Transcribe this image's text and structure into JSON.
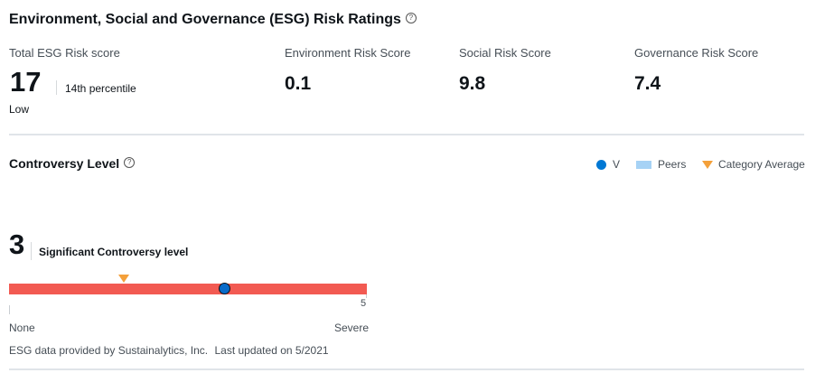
{
  "esg": {
    "title": "Environment, Social and Governance (ESG) Risk Ratings",
    "help_icon": "question-circle-icon",
    "total_label": "Total ESG Risk score",
    "total_value": "17",
    "percentile": "14th percentile",
    "risk_level": "Low",
    "environment_label": "Environment Risk Score",
    "environment_value": "0.1",
    "social_label": "Social Risk Score",
    "social_value": "9.8",
    "governance_label": "Governance Risk Score",
    "governance_value": "7.4"
  },
  "controversy": {
    "title": "Controversy Level",
    "legend": {
      "ticker": "V",
      "peers": "Peers",
      "category_average": "Category Average"
    },
    "level_value": "3",
    "level_text": "Significant Controversy level",
    "scale_max_label": "5",
    "scale_min_text": "None",
    "scale_max_text": "Severe",
    "ticker_level": 3,
    "category_average_level": 1.6,
    "scale_min": 0,
    "scale_max": 5
  },
  "footer": {
    "source": "ESG data provided by Sustainalytics, Inc.",
    "updated": "Last updated on 5/2021"
  },
  "colors": {
    "bar": "#f25a52",
    "ticker_dot": "#0a6bc9",
    "peers": "#a6d2f5",
    "category_average": "#f4a03a"
  }
}
